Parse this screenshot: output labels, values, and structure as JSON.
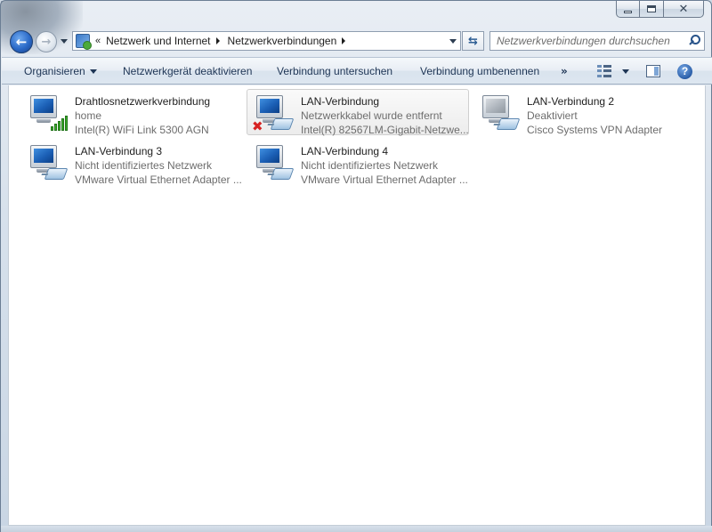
{
  "window": {
    "caption_buttons": {
      "minimize_icon": "minimize-icon",
      "maximize_icon": "maximize-icon",
      "close_icon": "close-icon"
    }
  },
  "navigation": {
    "back_icon": "back-arrow-icon",
    "forward_icon": "forward-arrow-icon",
    "overflow_chevron": "«",
    "breadcrumbs": [
      {
        "label": "Netzwerk und Internet"
      },
      {
        "label": "Netzwerkverbindungen"
      }
    ],
    "refresh_icon": "refresh-icon"
  },
  "search": {
    "placeholder": "Netzwerkverbindungen durchsuchen",
    "icon": "search-icon"
  },
  "command_bar": {
    "organize_label": "Organisieren",
    "disable_label": "Netzwerkgerät deaktivieren",
    "diagnose_label": "Verbindung untersuchen",
    "rename_label": "Verbindung umbenennen",
    "more_label": "»",
    "views_icon": "change-view-icon",
    "preview_icon": "preview-pane-icon",
    "help_icon": "help-icon",
    "help_label": "?"
  },
  "connections": [
    {
      "name": "Drahtlosnetzwerkverbindung",
      "status": "home",
      "device": "Intel(R) WiFi Link 5300 AGN",
      "icon": "wireless-network-icon"
    },
    {
      "name": "LAN-Verbindung",
      "status": "Netzwerkkabel wurde entfernt",
      "device": "Intel(R) 82567LM-Gigabit-Netzwe...",
      "icon": "disconnected-lan-icon"
    },
    {
      "name": "LAN-Verbindung 2",
      "status": "Deaktiviert",
      "device": "Cisco Systems VPN Adapter",
      "icon": "disabled-lan-icon"
    },
    {
      "name": "LAN-Verbindung 3",
      "status": "Nicht identifiziertes Netzwerk",
      "device": "VMware Virtual Ethernet Adapter ...",
      "icon": "lan-icon"
    },
    {
      "name": "LAN-Verbindung 4",
      "status": "Nicht identifiziertes Netzwerk",
      "device": "VMware Virtual Ethernet Adapter ...",
      "icon": "lan-icon"
    }
  ],
  "colors": {
    "accent": "#1b5fb5",
    "error_mark": "#d62222",
    "signal": "#3dae2b",
    "secondary_text": "#6d6d6d"
  }
}
